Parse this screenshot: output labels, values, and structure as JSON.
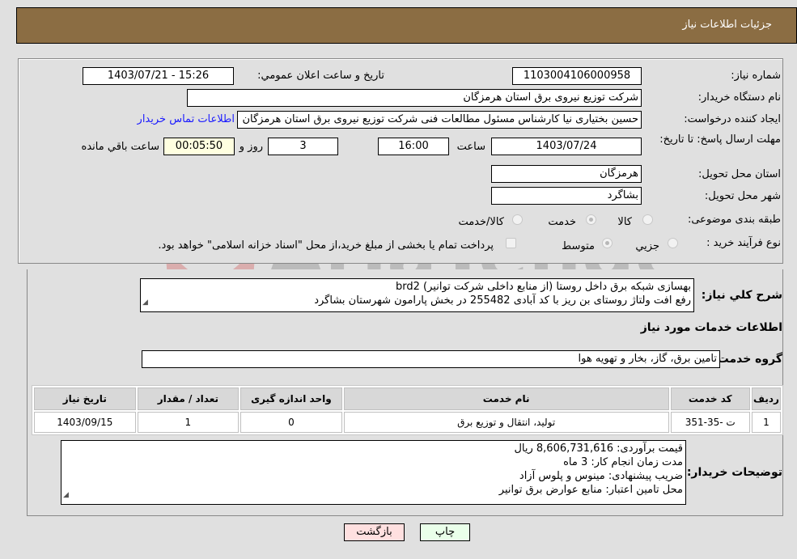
{
  "header": {
    "title": "جزئیات اطلاعات نیاز"
  },
  "form": {
    "need_number": {
      "label": "شماره نیاز:",
      "value": "1103004106000958"
    },
    "announce_datetime": {
      "label": "تاریخ و ساعت اعلان عمومي:",
      "value": "1403/07/21 - 15:26"
    },
    "buyer_org": {
      "label": "نام دستگاه خريدار:",
      "value": "شرکت توزیع نیروی برق استان هرمزگان"
    },
    "requester": {
      "label": "ايجاد کننده درخواست:",
      "value": "حسین بختیاری نیا کارشناس مسئول مطالعات فنی شرکت توزیع نیروی برق استان هرمزگان"
    },
    "buyer_contact_link": "اطلاعات تماس خريدار",
    "deadline": {
      "label": "مهلت ارسال پاسخ: تا تاريخ:",
      "date": "1403/07/24",
      "time_label": "ساعت",
      "time": "16:00",
      "days": "3",
      "days_label": "روز و",
      "remaining": "00:05:50",
      "remaining_label": "ساعت باقي مانده"
    },
    "province": {
      "label": "استان محل تحويل:",
      "value": "هرمزگان"
    },
    "city": {
      "label": "شهر محل تحويل:",
      "value": "بشاگرد"
    },
    "category": {
      "label": "طبقه بندی موضوعی:",
      "options": [
        "کالا",
        "خدمت",
        "کالا/خدمت"
      ],
      "selected": "خدمت"
    },
    "purchase_type": {
      "label": "نوع فرآيند خريد :",
      "options": [
        "جزيي",
        "متوسط"
      ],
      "selected": "متوسط",
      "treasury_note": "پرداخت تمام يا بخشی از مبلغ خريد،از محل \"اسناد خزانه اسلامی\" خواهد بود."
    }
  },
  "description": {
    "label": "شرح كلي نياز:",
    "lines": [
      "بهسازی شبکه برق داخل روستا (از منابع داخلی شرکت توانیر) brd2",
      "رفع افت ولتاژ روستای بن ریز با کد آبادی 255482 در بخش پارامون شهرستان بشاگرد"
    ]
  },
  "services_section": {
    "title": "اطلاعات خدمات مورد نياز",
    "group_label": "گروه خدمت:",
    "group_value": "تامين برق، گاز، بخار و تهويه هوا",
    "table": {
      "headers": [
        "رديف",
        "کد خدمت",
        "نام خدمت",
        "واحد اندازه گيری",
        "تعداد / مقدار",
        "تاريخ نياز"
      ],
      "rows": [
        [
          "1",
          "ت -35-351",
          "توليد، انتقال و توزيع برق",
          "0",
          "1",
          "1403/09/15"
        ]
      ]
    }
  },
  "buyer_notes": {
    "label": "توضيحات خريدار:",
    "lines": [
      "قیمت برآوردی:  8,606,731,616 ریال",
      "مدت زمان انجام کار: 3 ماه",
      "ضریب پیشنهادی: مینوس و پلوس آزاد",
      "محل تامین اعتبار: منابع عوارض برق توانیر"
    ]
  },
  "buttons": {
    "print": "چاپ",
    "back": "بازگشت"
  },
  "colors": {
    "header_bg": "#8b6d43",
    "print_bg": "#eaffea",
    "back_bg": "#ffe0e0",
    "link": "#1a1aff",
    "remaining_bg": "#ffffe0"
  },
  "watermark": {
    "text": "AriaTender.neT"
  }
}
